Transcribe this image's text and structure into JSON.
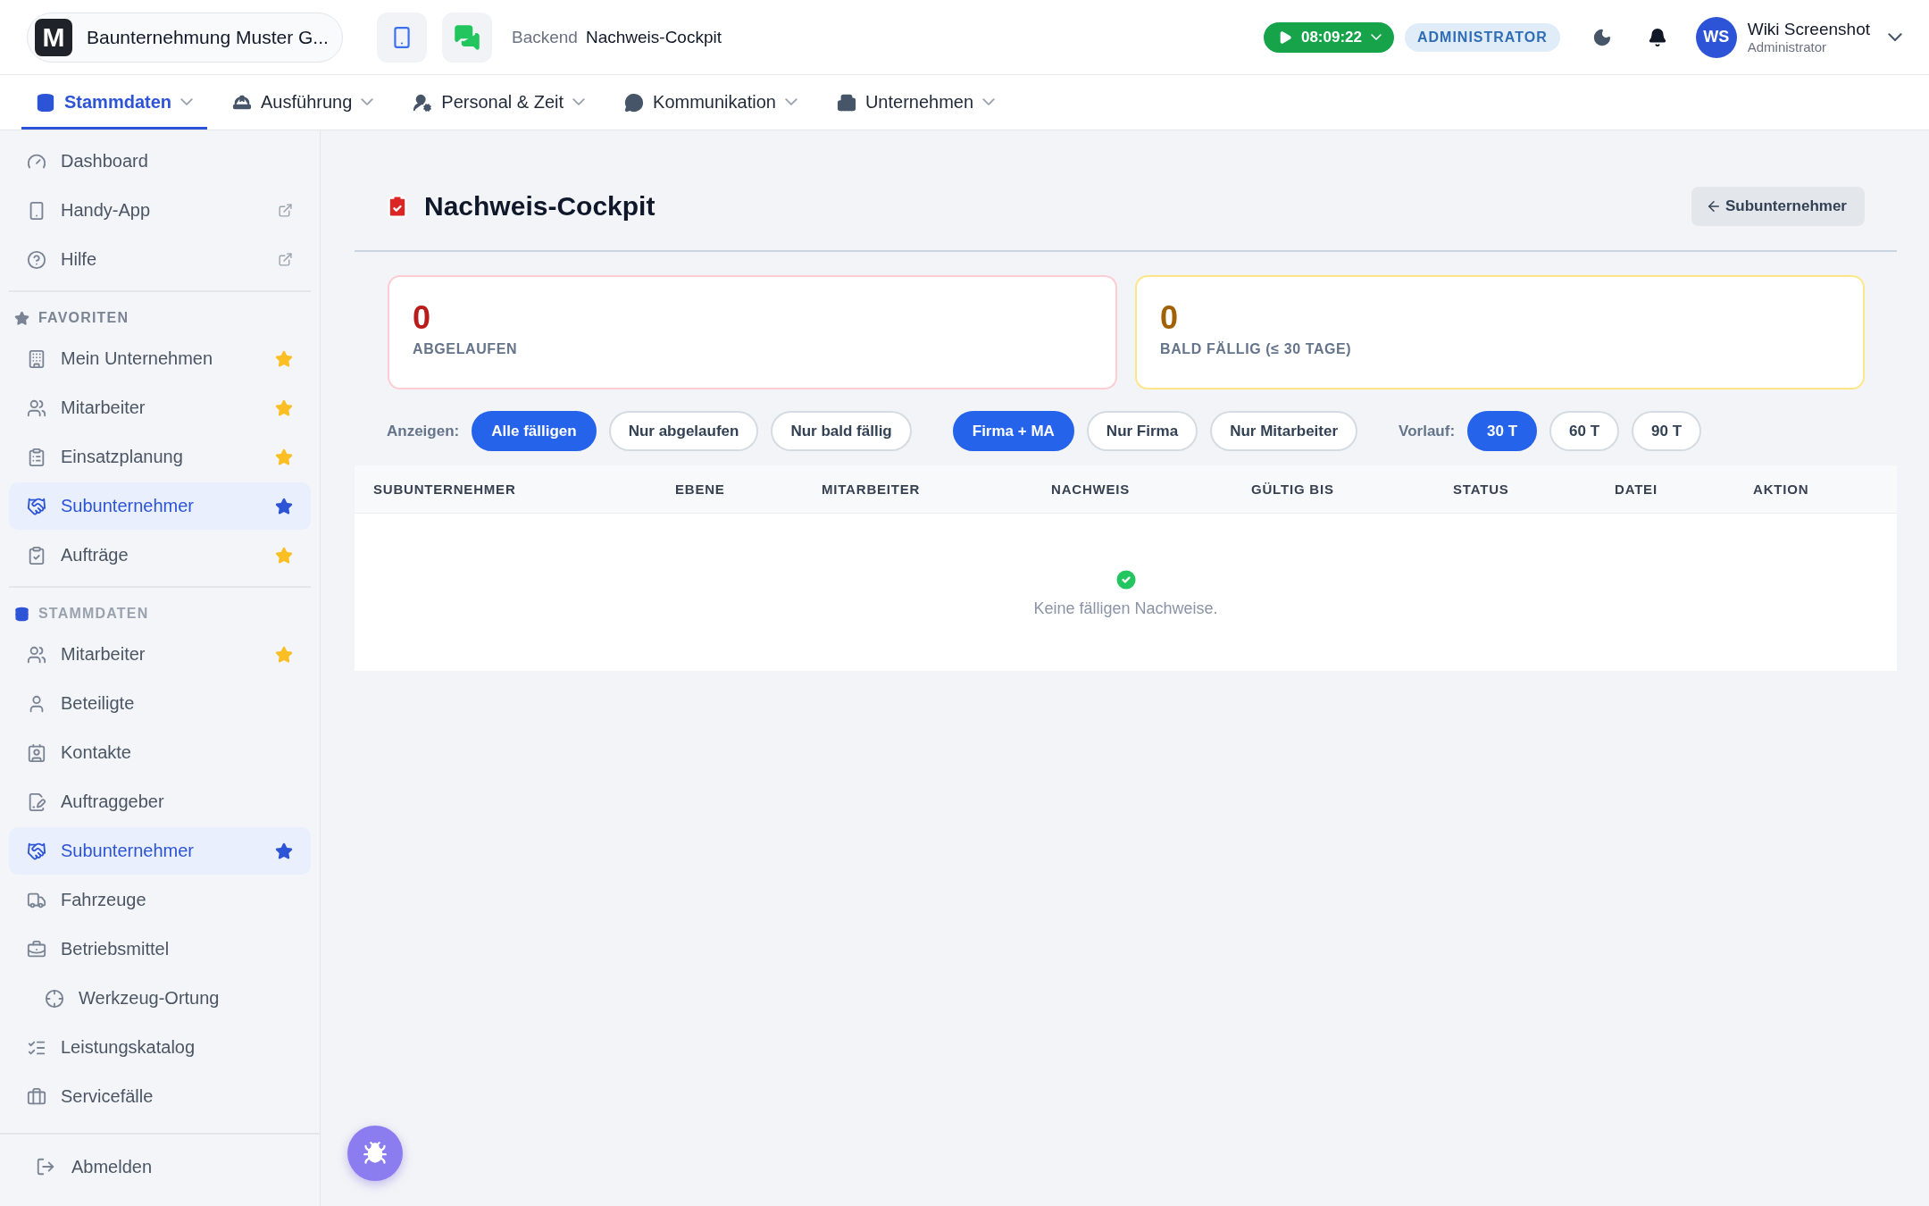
{
  "brand": {
    "logo_text": "M",
    "name": "Baunternehmung Muster G..."
  },
  "breadcrumb": {
    "section": "Backend",
    "page": "Nachweis-Cockpit"
  },
  "timer": {
    "time": "08:09:22",
    "running": true
  },
  "role_badge": "ADMINISTRATOR",
  "user": {
    "initials": "WS",
    "name": "Wiki Screenshot",
    "role": "Administrator"
  },
  "nav_tabs": [
    {
      "label": "Stammdaten",
      "selected": true
    },
    {
      "label": "Ausführung",
      "selected": false
    },
    {
      "label": "Personal & Zeit",
      "selected": false
    },
    {
      "label": "Kommunikation",
      "selected": false
    },
    {
      "label": "Unternehmen",
      "selected": false
    }
  ],
  "sidebar": {
    "top_items": [
      {
        "label": "Dashboard",
        "external": false
      },
      {
        "label": "Handy-App",
        "external": true
      },
      {
        "label": "Hilfe",
        "external": true
      }
    ],
    "sections": [
      {
        "title": "FAVORITEN",
        "items": [
          {
            "label": "Mein Unternehmen",
            "favorite": true,
            "selected": false
          },
          {
            "label": "Mitarbeiter",
            "favorite": true,
            "selected": false
          },
          {
            "label": "Einsatzplanung",
            "favorite": true,
            "selected": false
          },
          {
            "label": "Subunternehmer",
            "favorite": true,
            "selected": true
          },
          {
            "label": "Aufträge",
            "favorite": true,
            "selected": false
          }
        ]
      },
      {
        "title": "STAMMDATEN",
        "items": [
          {
            "label": "Mitarbeiter",
            "favorite": true,
            "selected": false
          },
          {
            "label": "Beteiligte",
            "favorite": false,
            "selected": false
          },
          {
            "label": "Kontakte",
            "favorite": false,
            "selected": false
          },
          {
            "label": "Auftraggeber",
            "favorite": false,
            "selected": false
          },
          {
            "label": "Subunternehmer",
            "favorite": true,
            "selected": true
          },
          {
            "label": "Fahrzeuge",
            "favorite": false,
            "selected": false
          },
          {
            "label": "Betriebsmittel",
            "favorite": false,
            "selected": false,
            "children": [
              {
                "label": "Werkzeug-Ortung",
                "favorite": false,
                "selected": false
              }
            ]
          },
          {
            "label": "Leistungskatalog",
            "favorite": false,
            "selected": false
          },
          {
            "label": "Servicefälle",
            "favorite": false,
            "selected": false
          }
        ]
      }
    ],
    "logout": "Abmelden"
  },
  "page": {
    "title": "Nachweis-Cockpit",
    "back_button": "Subunternehmer"
  },
  "stats": [
    {
      "kind": "expired",
      "value": "0",
      "label": "ABGELAUFEN"
    },
    {
      "kind": "due",
      "value": "0",
      "label": "BALD FÄLLIG (≤ 30 TAGE)"
    }
  ],
  "filters": [
    {
      "label": "Anzeigen:",
      "options": [
        {
          "label": "Alle fälligen",
          "selected": true
        },
        {
          "label": "Nur abgelaufen",
          "selected": false
        },
        {
          "label": "Nur bald fällig",
          "selected": false
        }
      ]
    },
    {
      "options": [
        {
          "label": "Firma + MA",
          "selected": true
        },
        {
          "label": "Nur Firma",
          "selected": false
        },
        {
          "label": "Nur Mitarbeiter",
          "selected": false
        }
      ]
    },
    {
      "label": "Vorlauf:",
      "options": [
        {
          "label": "30 T",
          "selected": true
        },
        {
          "label": "60 T",
          "selected": false
        },
        {
          "label": "90 T",
          "selected": false
        }
      ]
    }
  ],
  "table": {
    "columns": [
      "SUBUNTERNEHMER",
      "EBENE",
      "MITARBEITER",
      "NACHWEIS",
      "GÜLTIG BIS",
      "STATUS",
      "DATEI",
      "AKTION"
    ],
    "empty_message": "Keine fälligen Nachweise."
  }
}
